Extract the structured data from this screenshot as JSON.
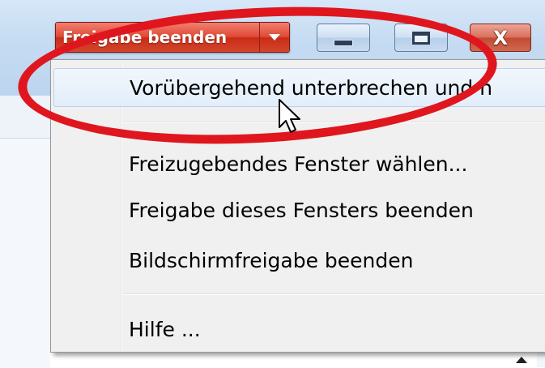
{
  "toolbar": {
    "split_button_label": "Freigabe beenden",
    "split_button_color": "#d9412c"
  },
  "caption_buttons": {
    "close_glyph": "X"
  },
  "menu": {
    "items": [
      {
        "label": "Vorübergehend unterbrechen und n",
        "highlighted": true
      },
      {
        "label": "Freizugebendes Fenster wählen..."
      },
      {
        "label": "Freigabe dieses Fensters beenden"
      },
      {
        "label": "Bildschirmfreigabe beenden"
      },
      {
        "label": "Hilfe ..."
      }
    ]
  },
  "annotation": {
    "shape": "ellipse",
    "color": "#e0161e"
  },
  "icons": [
    "dropdown-arrow-icon",
    "minimize-icon",
    "maximize-icon",
    "close-icon",
    "mouse-cursor-icon"
  ]
}
